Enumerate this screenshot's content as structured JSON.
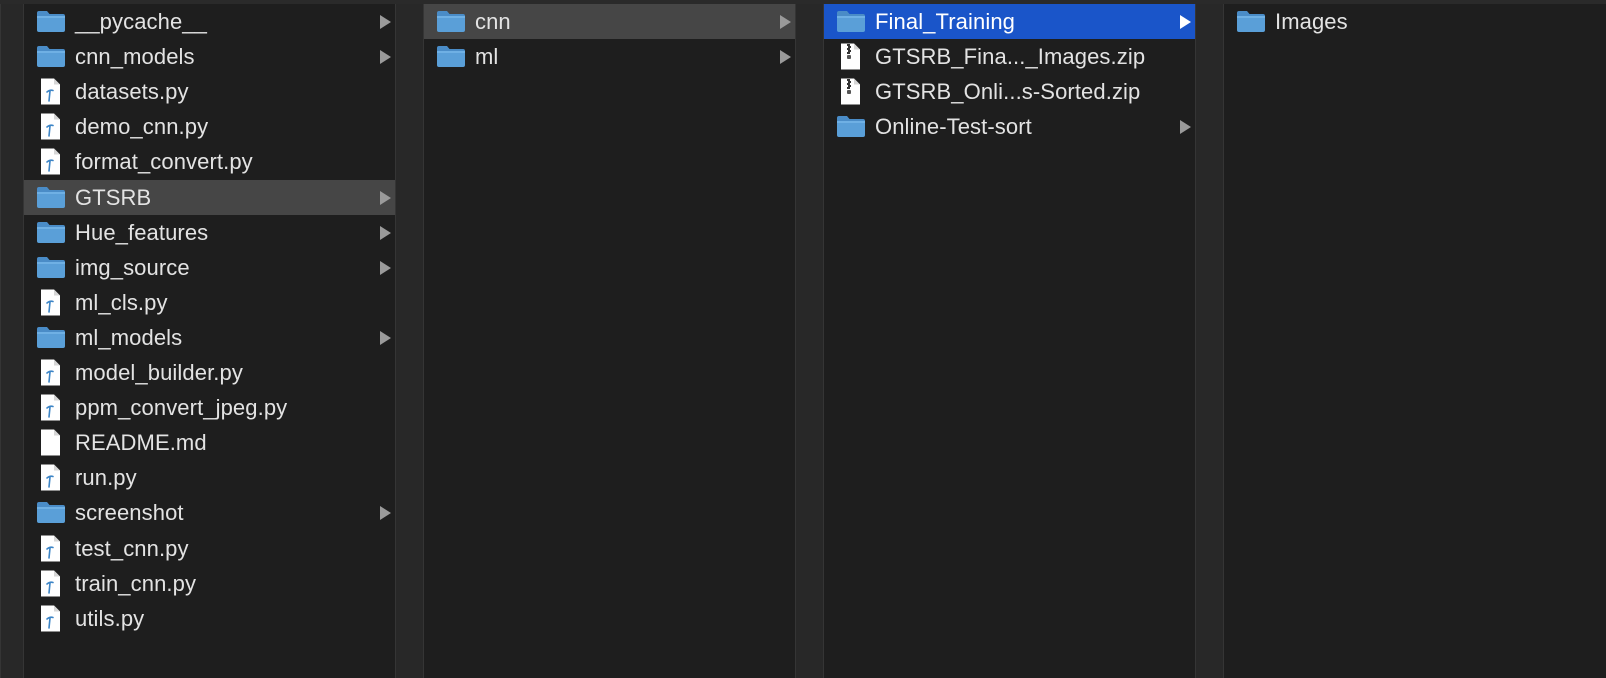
{
  "colors": {
    "background": "#1e1e1e",
    "divider": "#282828",
    "selected_inactive": "#464646",
    "selected_active": "#1a55c9",
    "folder": "#5a9fd8",
    "text": "#e3e3e3"
  },
  "columns": [
    {
      "items": [
        {
          "label": "__pycache__",
          "icon": "folder-icon",
          "has_children": true,
          "selected": "none"
        },
        {
          "label": "cnn_models",
          "icon": "folder-icon",
          "has_children": true,
          "selected": "none"
        },
        {
          "label": "datasets.py",
          "icon": "python-file-icon",
          "has_children": false,
          "selected": "none"
        },
        {
          "label": "demo_cnn.py",
          "icon": "python-file-icon",
          "has_children": false,
          "selected": "none"
        },
        {
          "label": "format_convert.py",
          "icon": "python-file-icon",
          "has_children": false,
          "selected": "none"
        },
        {
          "label": "GTSRB",
          "icon": "folder-icon",
          "has_children": true,
          "selected": "inactive"
        },
        {
          "label": "Hue_features",
          "icon": "folder-icon",
          "has_children": true,
          "selected": "none"
        },
        {
          "label": "img_source",
          "icon": "folder-icon",
          "has_children": true,
          "selected": "none"
        },
        {
          "label": "ml_cls.py",
          "icon": "python-file-icon",
          "has_children": false,
          "selected": "none"
        },
        {
          "label": "ml_models",
          "icon": "folder-icon",
          "has_children": true,
          "selected": "none"
        },
        {
          "label": "model_builder.py",
          "icon": "python-file-icon",
          "has_children": false,
          "selected": "none"
        },
        {
          "label": "ppm_convert_jpeg.py",
          "icon": "python-file-icon",
          "has_children": false,
          "selected": "none"
        },
        {
          "label": "README.md",
          "icon": "document-icon",
          "has_children": false,
          "selected": "none"
        },
        {
          "label": "run.py",
          "icon": "python-file-icon",
          "has_children": false,
          "selected": "none"
        },
        {
          "label": "screenshot",
          "icon": "folder-icon",
          "has_children": true,
          "selected": "none"
        },
        {
          "label": "test_cnn.py",
          "icon": "python-file-icon",
          "has_children": false,
          "selected": "none"
        },
        {
          "label": "train_cnn.py",
          "icon": "python-file-icon",
          "has_children": false,
          "selected": "none"
        },
        {
          "label": "utils.py",
          "icon": "python-file-icon",
          "has_children": false,
          "selected": "none"
        }
      ]
    },
    {
      "items": [
        {
          "label": "cnn",
          "icon": "folder-icon",
          "has_children": true,
          "selected": "inactive"
        },
        {
          "label": "ml",
          "icon": "folder-icon",
          "has_children": true,
          "selected": "none"
        }
      ]
    },
    {
      "items": [
        {
          "label": "Final_Training",
          "icon": "folder-icon",
          "has_children": true,
          "selected": "active"
        },
        {
          "label": "GTSRB_Fina..._Images.zip",
          "icon": "zip-file-icon",
          "has_children": false,
          "selected": "none"
        },
        {
          "label": "GTSRB_Onli...s-Sorted.zip",
          "icon": "zip-file-icon",
          "has_children": false,
          "selected": "none"
        },
        {
          "label": "Online-Test-sort",
          "icon": "folder-icon",
          "has_children": true,
          "selected": "none"
        }
      ]
    },
    {
      "items": [
        {
          "label": "Images",
          "icon": "folder-icon",
          "has_children": false,
          "selected": "none"
        }
      ]
    }
  ]
}
